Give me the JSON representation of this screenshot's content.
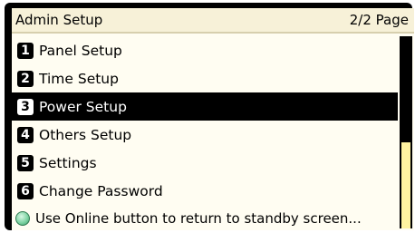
{
  "header": {
    "title": "Admin Setup",
    "page": "2/2 Page"
  },
  "menu": {
    "items": [
      {
        "num": "1",
        "label": "Panel Setup"
      },
      {
        "num": "2",
        "label": "Time Setup"
      },
      {
        "num": "3",
        "label": "Power Setup"
      },
      {
        "num": "4",
        "label": "Others Setup"
      },
      {
        "num": "5",
        "label": "Settings"
      },
      {
        "num": "6",
        "label": "Change Password"
      }
    ],
    "selected": "Power Setup"
  },
  "hint": {
    "text": "Use Online button to return to standby screen..."
  },
  "scrollbar": {
    "position_fraction": 0.55,
    "visible_fraction": 0.45
  },
  "colors": {
    "selected_bg": "#000000",
    "scroll_thumb": "#fff3a0",
    "led": "#7fd4a4"
  }
}
